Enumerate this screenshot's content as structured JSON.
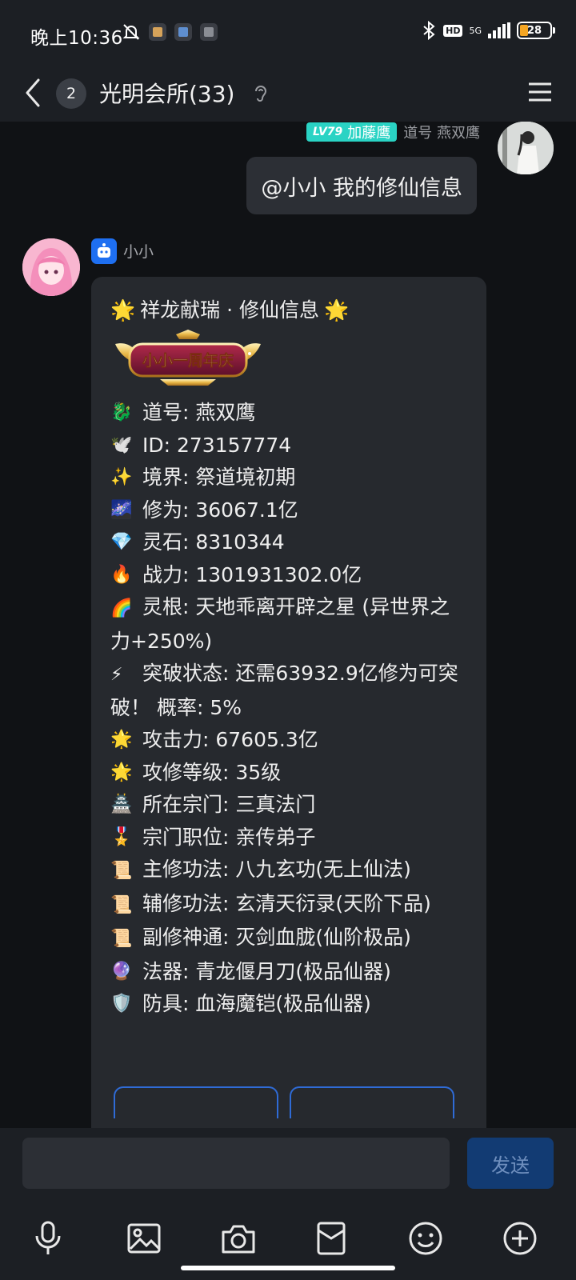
{
  "status_bar": {
    "time": "晚上10:36",
    "network": "5G",
    "hd": "HD",
    "battery": "28"
  },
  "header": {
    "unread_count": "2",
    "title": "光明会所(33)"
  },
  "message_self": {
    "level": "LV79",
    "name": "加藤鹰",
    "subtitle": "道号 燕双鹰",
    "text": "@小小 我的修仙信息"
  },
  "message_bot": {
    "name": "小小",
    "title": "祥龙献瑞 · 修仙信息",
    "banner_text": "小小一周年庆",
    "lines": [
      {
        "emoji": "🐉",
        "text": "道号: 燕双鹰"
      },
      {
        "emoji": "🕊️",
        "text": "ID: 273157774"
      },
      {
        "emoji": "✨",
        "text": "境界: 祭道境初期"
      },
      {
        "emoji": "🌌",
        "text": "修为: 36067.1亿"
      },
      {
        "emoji": "💎",
        "text": "灵石: 8310344"
      },
      {
        "emoji": "🔥",
        "text": "战力: 1301931302.0亿"
      },
      {
        "emoji": "🌈",
        "text": "灵根: 天地乖离开辟之星 (异世界之力+250%)"
      },
      {
        "emoji": "⚡",
        "text": "突破状态: 还需63932.9亿修为可突破！ 概率: 5%"
      },
      {
        "emoji": "🌟",
        "text": "攻击力: 67605.3亿"
      },
      {
        "emoji": "🌟",
        "text": "攻修等级: 35级"
      },
      {
        "emoji": "🏯",
        "text": "所在宗门: 三真法门"
      },
      {
        "emoji": "🎖️",
        "text": "宗门职位: 亲传弟子"
      },
      {
        "emoji": "📜",
        "text": "主修功法: 八九玄功(无上仙法)"
      },
      {
        "emoji": "📜",
        "text": "辅修功法: 玄清天衍录(天阶下品)"
      },
      {
        "emoji": "📜",
        "text": "副修神通: 灭剑血胧(仙阶极品)"
      },
      {
        "emoji": "🔮",
        "text": "法器: 青龙偃月刀(极品仙器)"
      },
      {
        "emoji": "🛡️",
        "text": "防具: 血海魔铠(极品仙器)"
      }
    ]
  },
  "composer": {
    "input_value": "",
    "send_label": "发送"
  },
  "colors": {
    "accent": "#1e6ff1",
    "level_tag": "#2ad3c4",
    "send_bg": "#123b73"
  }
}
